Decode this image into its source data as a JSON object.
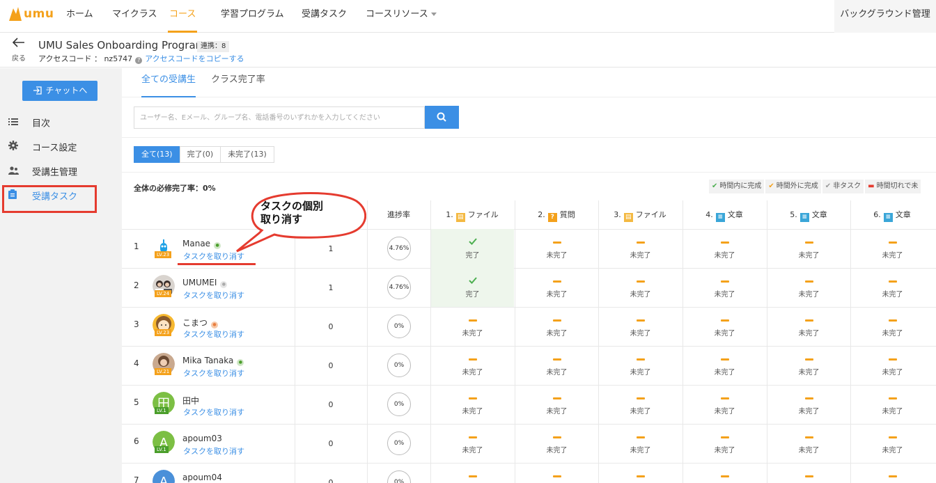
{
  "nav": {
    "logo_text": "umu",
    "items": [
      "ホーム",
      "マイクラス",
      "コース",
      "学習プログラム",
      "受講タスク",
      "コースリソース"
    ],
    "active_index": 2,
    "admin": "バックグラウンド管理"
  },
  "header": {
    "back_label": "戻る",
    "title": "UMU Sales Onboarding Program",
    "sync_badge": "連携：8",
    "access_label": "アクセスコード ： nz5747",
    "copy_link": "アクセスコードをコピーする"
  },
  "sidebar": {
    "chat_button": "チャットへ",
    "items": [
      {
        "label": "目次",
        "icon": "list-icon"
      },
      {
        "label": "コース設定",
        "icon": "gear-icon"
      },
      {
        "label": "受講生管理",
        "icon": "users-icon"
      },
      {
        "label": "受講タスク",
        "icon": "clipboard-icon"
      }
    ],
    "active_index": 3
  },
  "tabs": [
    {
      "label": "全ての受講生",
      "active": true
    },
    {
      "label": "クラス完了率",
      "active": false
    }
  ],
  "search": {
    "placeholder": "ユーザー名、Eメール、グループ名、電話番号のいずれかを入力してください"
  },
  "filters": [
    {
      "label": "全て(13)",
      "active": true
    },
    {
      "label": "完了(0)",
      "active": false
    },
    {
      "label": "未完了(13)",
      "active": false
    }
  ],
  "completion_rate": "全体の必修完了率：0%",
  "legend": [
    {
      "label": "時間内に完成",
      "mark": "✔",
      "color": "#4caf50"
    },
    {
      "label": "時間外に完成",
      "mark": "✔",
      "color": "#f4a11b"
    },
    {
      "label": "非タスク",
      "mark": "✔",
      "color": "#999999"
    },
    {
      "label": "時間切れで未",
      "mark": "▬",
      "color": "#e53b2f"
    }
  ],
  "table": {
    "progress_header": "進捗率",
    "task_columns": [
      {
        "num": "1.",
        "label": "ファイル",
        "icon": "file-icon",
        "color": "#f4b942",
        "glyph": "▤"
      },
      {
        "num": "2.",
        "label": "質問",
        "icon": "question-icon",
        "color": "#f4a11b",
        "glyph": "?"
      },
      {
        "num": "3.",
        "label": "ファイル",
        "icon": "file-icon",
        "color": "#f4b942",
        "glyph": "▤"
      },
      {
        "num": "4.",
        "label": "文章",
        "icon": "article-icon",
        "color": "#3aa6d8",
        "glyph": "≡"
      },
      {
        "num": "5.",
        "label": "文章",
        "icon": "article-icon",
        "color": "#3aa6d8",
        "glyph": "≡"
      },
      {
        "num": "6.",
        "label": "文章",
        "icon": "article-icon",
        "color": "#3aa6d8",
        "glyph": "≡"
      }
    ],
    "done_label": "完了",
    "undone_label": "未完了",
    "cancel_link": "タスクを取り消す",
    "rows": [
      {
        "num": "1",
        "name": "Manae",
        "level": "LV.23",
        "count": "1",
        "progress": "4.76%",
        "done": [
          true,
          false,
          false,
          false,
          false,
          false
        ],
        "avatar": "robot",
        "medal": "green"
      },
      {
        "num": "2",
        "name": "UMUMEI",
        "level": "LV.24",
        "count": "1",
        "progress": "4.76%",
        "done": [
          true,
          false,
          false,
          false,
          false,
          false
        ],
        "avatar": "photo1",
        "medal": "grey"
      },
      {
        "num": "3",
        "name": "こまつ",
        "level": "LV.23",
        "count": "0",
        "progress": "0%",
        "done": [
          false,
          false,
          false,
          false,
          false,
          false
        ],
        "avatar": "cartoon",
        "medal": "orange"
      },
      {
        "num": "4",
        "name": "Mika Tanaka",
        "level": "LV.21",
        "count": "0",
        "progress": "0%",
        "done": [
          false,
          false,
          false,
          false,
          false,
          false
        ],
        "avatar": "photo2",
        "medal": "green"
      },
      {
        "num": "5",
        "name": "田中",
        "level": "LV.1",
        "count": "0",
        "progress": "0%",
        "done": [
          false,
          false,
          false,
          false,
          false,
          false
        ],
        "avatar": "letter",
        "avatar_letter": "田",
        "avatar_color": "#7cbf44"
      },
      {
        "num": "6",
        "name": "apoum03",
        "level": "LV.1",
        "count": "0",
        "progress": "0%",
        "done": [
          false,
          false,
          false,
          false,
          false,
          false
        ],
        "avatar": "letter",
        "avatar_letter": "A",
        "avatar_color": "#7cbf44"
      },
      {
        "num": "7",
        "name": "apoum04",
        "level": "",
        "count": "0",
        "progress": "0%",
        "done": [
          false,
          false,
          false,
          false,
          false,
          false
        ],
        "avatar": "letter",
        "avatar_letter": "A",
        "avatar_color": "#4a90d9"
      }
    ]
  },
  "callout": {
    "line1": "タスクの個別",
    "line2": "取り消す"
  }
}
